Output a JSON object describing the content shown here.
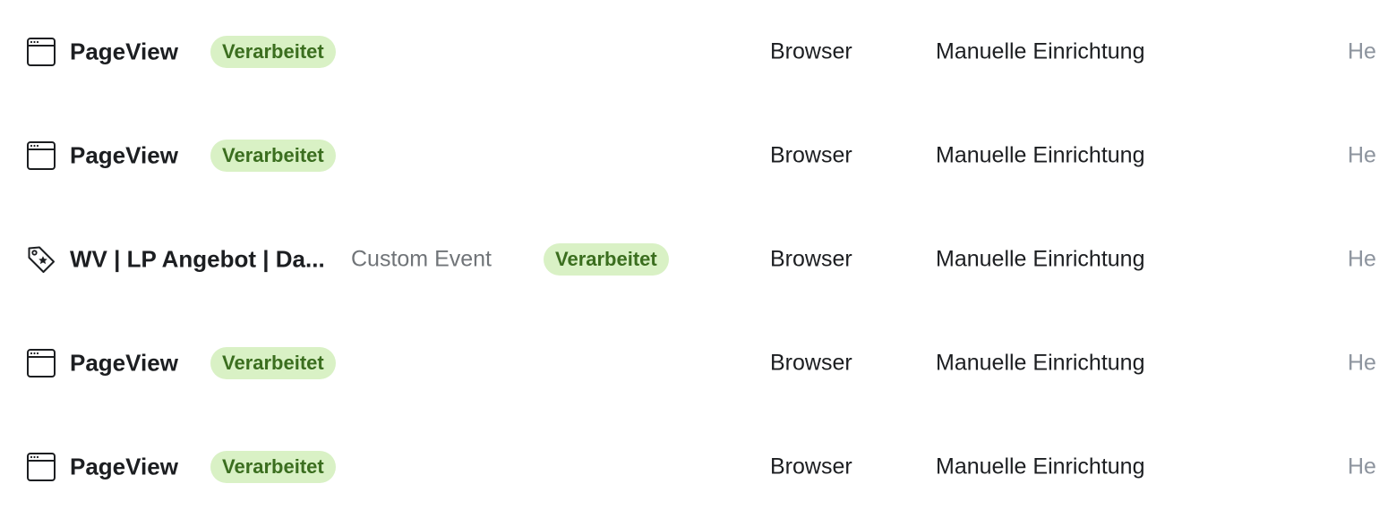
{
  "events": [
    {
      "icon": "browser-window-icon",
      "name": "PageView",
      "subtype": "",
      "status": "Verarbeitet",
      "source": "Browser",
      "setup": "Manuelle Einrichtung",
      "extra": "He"
    },
    {
      "icon": "browser-window-icon",
      "name": "PageView",
      "subtype": "",
      "status": "Verarbeitet",
      "source": "Browser",
      "setup": "Manuelle Einrichtung",
      "extra": "He"
    },
    {
      "icon": "custom-event-tag-icon",
      "name": "WV | LP Angebot | Da...",
      "subtype": "Custom Event",
      "status": "Verarbeitet",
      "source": "Browser",
      "setup": "Manuelle Einrichtung",
      "extra": "He"
    },
    {
      "icon": "browser-window-icon",
      "name": "PageView",
      "subtype": "",
      "status": "Verarbeitet",
      "source": "Browser",
      "setup": "Manuelle Einrichtung",
      "extra": "He"
    },
    {
      "icon": "browser-window-icon",
      "name": "PageView",
      "subtype": "",
      "status": "Verarbeitet",
      "source": "Browser",
      "setup": "Manuelle Einrichtung",
      "extra": "He"
    }
  ],
  "colors": {
    "badge_bg": "#d9f1c5",
    "badge_text": "#3b6e1f",
    "primary_text": "#1c1e21",
    "secondary_text": "#707478",
    "faded_text": "#8d949e"
  }
}
